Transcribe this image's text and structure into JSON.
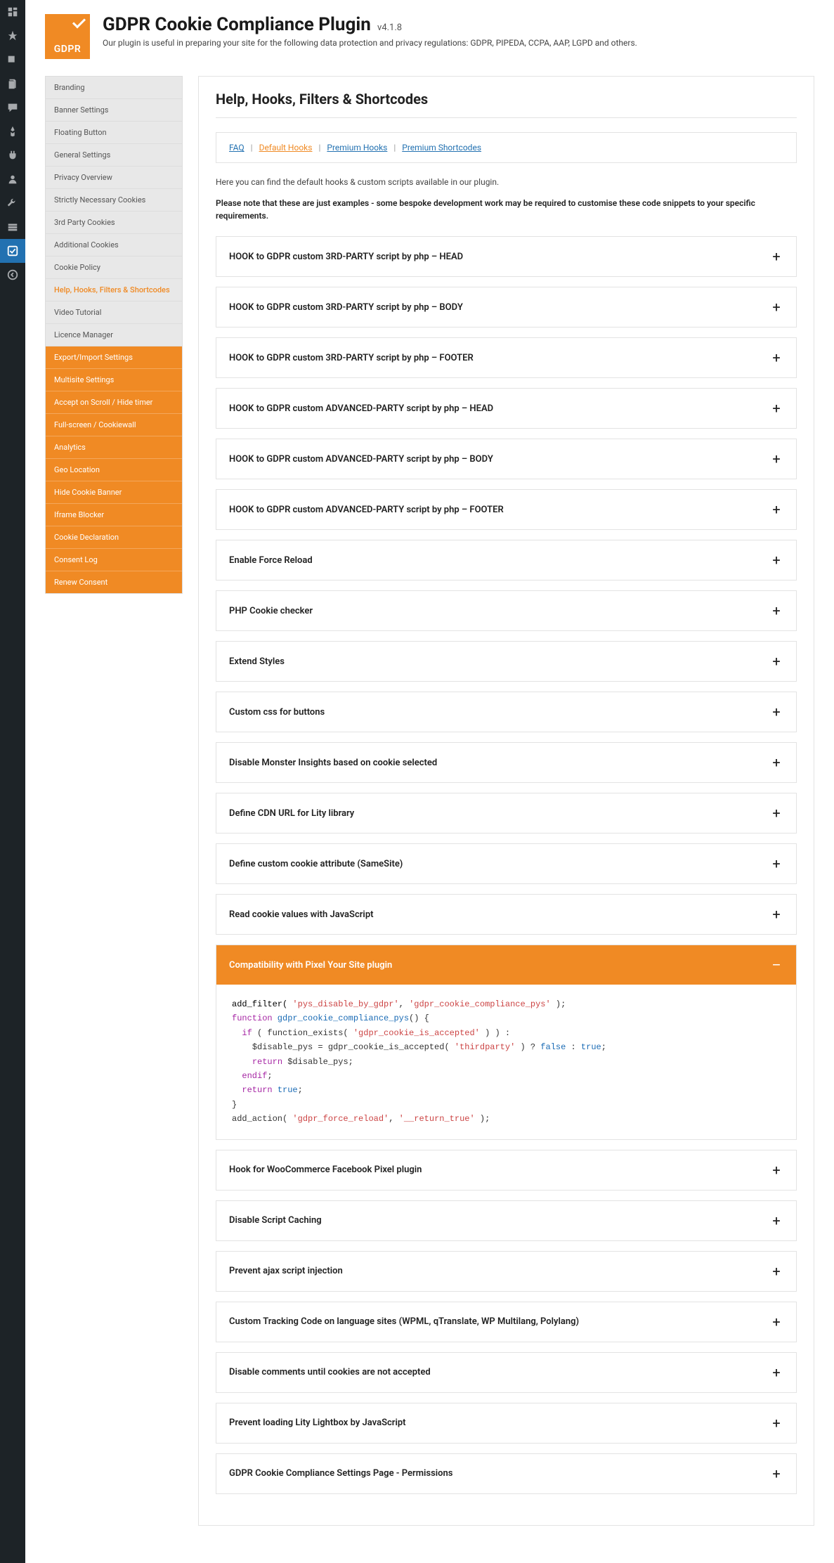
{
  "header": {
    "logo_text": "GDPR",
    "title": "GDPR Cookie Compliance Plugin",
    "version": "v4.1.8",
    "subtitle": "Our plugin is useful in preparing your site for the following data protection and privacy regulations: GDPR, PIPEDA, CCPA, AAP, LGPD and others."
  },
  "sidenav": {
    "items": [
      {
        "label": "Branding",
        "type": "normal"
      },
      {
        "label": "Banner Settings",
        "type": "normal"
      },
      {
        "label": "Floating Button",
        "type": "normal"
      },
      {
        "label": "General Settings",
        "type": "normal"
      },
      {
        "label": "Privacy Overview",
        "type": "normal"
      },
      {
        "label": "Strictly Necessary Cookies",
        "type": "normal"
      },
      {
        "label": "3rd Party Cookies",
        "type": "normal"
      },
      {
        "label": "Additional Cookies",
        "type": "normal"
      },
      {
        "label": "Cookie Policy",
        "type": "normal"
      },
      {
        "label": "Help, Hooks, Filters & Shortcodes",
        "type": "current"
      },
      {
        "label": "Video Tutorial",
        "type": "normal"
      },
      {
        "label": "Licence Manager",
        "type": "normal"
      },
      {
        "label": "Export/Import Settings",
        "type": "premium"
      },
      {
        "label": "Multisite Settings",
        "type": "premium"
      },
      {
        "label": "Accept on Scroll / Hide timer",
        "type": "premium"
      },
      {
        "label": "Full-screen / Cookiewall",
        "type": "premium"
      },
      {
        "label": "Analytics",
        "type": "premium"
      },
      {
        "label": "Geo Location",
        "type": "premium"
      },
      {
        "label": "Hide Cookie Banner",
        "type": "premium"
      },
      {
        "label": "Iframe Blocker",
        "type": "premium"
      },
      {
        "label": "Cookie Declaration",
        "type": "premium"
      },
      {
        "label": "Consent Log",
        "type": "premium"
      },
      {
        "label": "Renew Consent",
        "type": "premium"
      }
    ]
  },
  "content": {
    "heading": "Help, Hooks, Filters & Shortcodes",
    "tabs": {
      "faq": "FAQ",
      "default_hooks": "Default Hooks",
      "premium_hooks": "Premium Hooks",
      "premium_shortcodes": "Premium Shortcodes",
      "sep": "|"
    },
    "intro": "Here you can find the default hooks & custom scripts available in our plugin.",
    "note": "Please note that these are just examples - some bespoke development work may be required to customise these code snippets to your specific requirements.",
    "accordions": [
      {
        "title": "HOOK to GDPR custom 3RD-PARTY script by php – HEAD",
        "open": false
      },
      {
        "title": "HOOK to GDPR custom 3RD-PARTY script by php – BODY",
        "open": false
      },
      {
        "title": "HOOK to GDPR custom 3RD-PARTY script by php – FOOTER",
        "open": false
      },
      {
        "title": "HOOK to GDPR custom ADVANCED-PARTY script by php – HEAD",
        "open": false
      },
      {
        "title": "HOOK to GDPR custom ADVANCED-PARTY script by php – BODY",
        "open": false
      },
      {
        "title": "HOOK to GDPR custom ADVANCED-PARTY script by php – FOOTER",
        "open": false
      },
      {
        "title": "Enable Force Reload",
        "open": false
      },
      {
        "title": "PHP Cookie checker",
        "open": false
      },
      {
        "title": "Extend Styles",
        "open": false
      },
      {
        "title": "Custom css for buttons",
        "open": false
      },
      {
        "title": "Disable Monster Insights based on cookie selected",
        "open": false
      },
      {
        "title": "Define CDN URL for Lity library",
        "open": false
      },
      {
        "title": "Define custom cookie attribute (SameSite)",
        "open": false
      },
      {
        "title": "Read cookie values with JavaScript",
        "open": false
      },
      {
        "title": "Compatibility with Pixel Your Site plugin",
        "open": true
      },
      {
        "title": "Hook for WooCommerce Facebook Pixel plugin",
        "open": false
      },
      {
        "title": "Disable Script Caching",
        "open": false
      },
      {
        "title": "Prevent ajax script injection",
        "open": false
      },
      {
        "title": "Custom Tracking Code on language sites (WPML, qTranslate, WP Multilang, Polylang)",
        "open": false
      },
      {
        "title": "Disable comments until cookies are not accepted",
        "open": false
      },
      {
        "title": "Prevent loading Lity Lightbox by JavaScript",
        "open": false
      },
      {
        "title": "GDPR Cookie Compliance Settings Page - Permissions",
        "open": false
      }
    ],
    "code": {
      "line1_fn": "add_filter( ",
      "line1_s1": "'pys_disable_by_gdpr'",
      "line1_c": ", ",
      "line1_s2": "'gdpr_cookie_compliance_pys'",
      "line1_end": " );",
      "line2_kw": "function",
      "line2_name": " gdpr_cookie_compliance_pys",
      "line2_rest": "() {",
      "line3_kw": "if",
      "line3_rest": " ( function_exists( ",
      "line3_s": "'gdpr_cookie_is_accepted'",
      "line3_end": " ) ) :",
      "line4_a": "$disable_pys = gdpr_cookie_is_accepted( ",
      "line4_s": "'thirdparty'",
      "line4_b": " ) ? ",
      "line4_false": "false",
      "line4_c": " : ",
      "line4_true": "true",
      "line4_end": ";",
      "line5_kw": "return",
      "line5_rest": " $disable_pys;",
      "line6_kw": "endif",
      "line6_rest": ";",
      "line7_kw": "return",
      "line7_true": " true",
      "line7_end": ";",
      "line8": "}",
      "line9_a": "add_action( ",
      "line9_s1": "'gdpr_force_reload'",
      "line9_b": ", ",
      "line9_s2": "'__return_true'",
      "line9_end": " );"
    }
  },
  "plus": "+",
  "minus": "–"
}
